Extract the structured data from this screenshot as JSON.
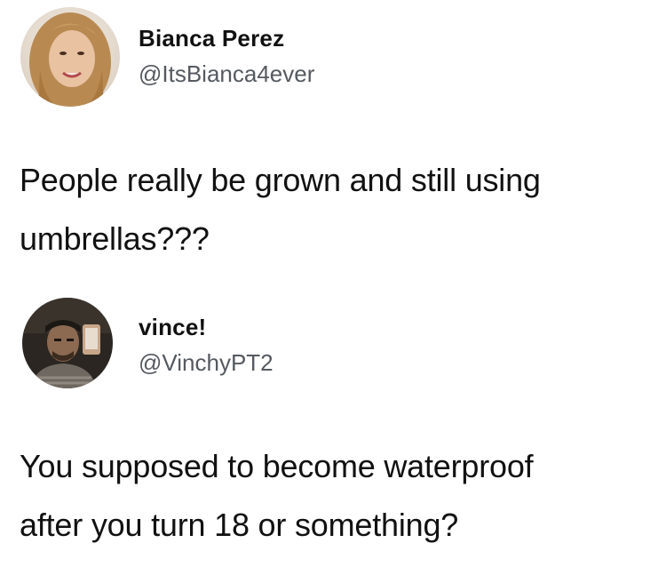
{
  "tweets": [
    {
      "name": "Bianca Perez",
      "handle": "@ItsBianca4ever",
      "avatar_icon": "user-avatar-photo",
      "text_lines": [
        "People really be grown and still using",
        "umbrellas???"
      ]
    },
    {
      "name": "vince!",
      "handle": "@VinchyPT2",
      "avatar_icon": "user-avatar-photo",
      "text_lines": [
        "You supposed to become waterproof",
        "after you turn 18 or something?"
      ]
    }
  ]
}
